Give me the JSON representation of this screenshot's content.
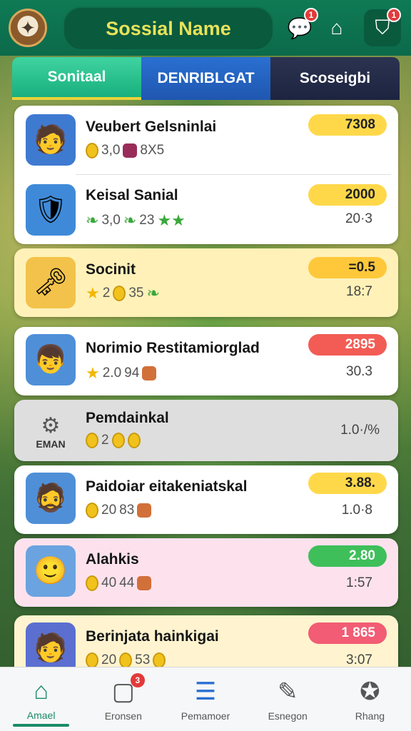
{
  "header": {
    "title": "Sossial Name",
    "avatar_icon": "compass-avatar-icon",
    "icons": [
      {
        "name": "chat-icon",
        "badge": "1"
      },
      {
        "name": "shop-icon",
        "badge": ""
      },
      {
        "name": "trophy-icon",
        "badge": "1"
      }
    ]
  },
  "tabs": [
    {
      "label": "Sonitaal"
    },
    {
      "label": "DENRIBLGAT"
    },
    {
      "label": "Scoseigbi"
    }
  ],
  "rows": [
    {
      "name": "Veubert Gelsninlai",
      "stats": [
        "3,0",
        "8X5"
      ],
      "score": "7308",
      "sub": ""
    },
    {
      "name": "Keisal Sanial",
      "stats": [
        "3,0",
        "23"
      ],
      "score": "2000",
      "sub": "20·3"
    },
    {
      "name": "Socinit",
      "stats": [
        "2",
        "35"
      ],
      "score": "=0.5",
      "sub": "18:7"
    },
    {
      "name": "Norimio Restitamiorglad",
      "stats": [
        "2.0",
        "94"
      ],
      "score": "2895",
      "sub": "30.3"
    },
    {
      "name": "Pemdainkal",
      "stats": [
        "2"
      ],
      "score": "",
      "sub": "1.0·/%",
      "thumb_label": "EMAN"
    },
    {
      "name": "Paidoiar eitakeniatskal",
      "stats": [
        "20",
        "83"
      ],
      "score": "3.88.",
      "sub": "1.0·8"
    },
    {
      "name": "Alahkis",
      "stats": [
        "40",
        "44"
      ],
      "score": "2.80",
      "sub": "1:57"
    },
    {
      "name": "Berinjata hainkigai",
      "stats": [
        "20",
        "53"
      ],
      "score": "1 865",
      "sub": "3:07"
    }
  ],
  "nav": [
    {
      "label": "Amael",
      "icon": "home-icon",
      "badge": ""
    },
    {
      "label": "Eronsen",
      "icon": "inbox-icon",
      "badge": "3"
    },
    {
      "label": "Pemamoer",
      "icon": "grid-list-icon",
      "badge": ""
    },
    {
      "label": "Esnegon",
      "icon": "chart-icon",
      "badge": ""
    },
    {
      "label": "Rhang",
      "icon": "medal-icon",
      "badge": ""
    }
  ]
}
